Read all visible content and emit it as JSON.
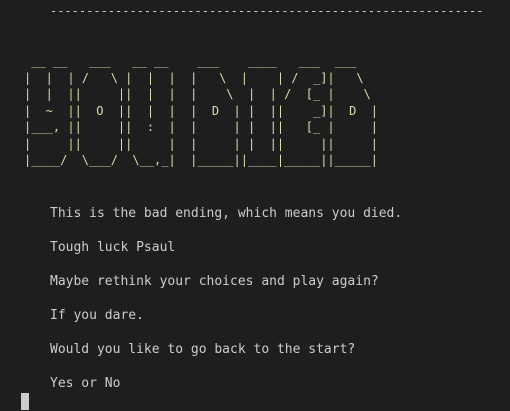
{
  "terminal": {
    "divider": "------------------------------------------------------------",
    "banner_lines": [
      " __ __   ___   __ __    ___    ____   ___  ___    ",
      "|  |  | /   \\ |  |  |  |   \\  |    | /  _]|   \\   ",
      "|  |  ||     ||  |  |  |    \\  |  | /  [_ |    \\  ",
      "|  ~  ||  O  ||  |  |  |  D  | |  ||    _]|  D  | ",
      "|___, ||     ||  :  |  |     | |  ||   [_ |     | ",
      "|     ||     ||     |  |     | |  ||     ||     | ",
      "|____/  \\___/  \\__,_|  |_____||____|_____||_____| "
    ],
    "messages": [
      "This is the bad ending, which means you died.",
      "Tough luck Psaul",
      "Maybe rethink your choices and play again?",
      "If you dare.",
      "Would you like to go back to the start?",
      "Yes or No"
    ]
  }
}
